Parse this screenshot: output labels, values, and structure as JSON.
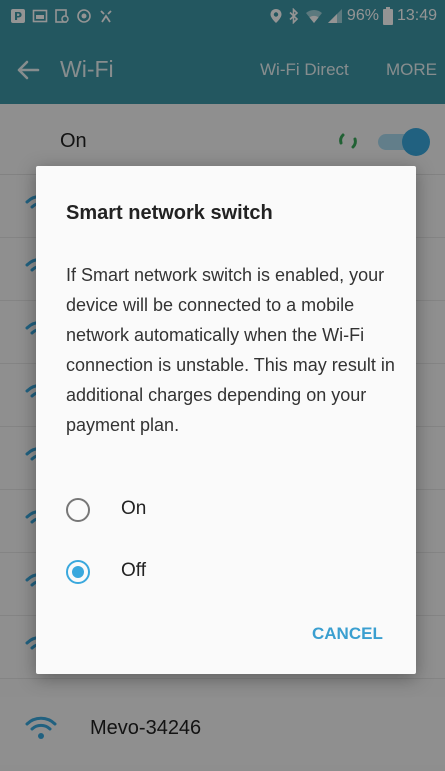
{
  "status_bar": {
    "battery": "96%",
    "time": "13:49"
  },
  "app_bar": {
    "title": "Wi-Fi",
    "wifi_direct": "Wi-Fi Direct",
    "more": "MORE"
  },
  "wifi_toggle": {
    "label": "On",
    "state": "on"
  },
  "networks": [
    {
      "name": "Mevo-34246"
    }
  ],
  "dialog": {
    "title": "Smart network switch",
    "body": "If Smart network switch is enabled, your device will be connected to a mobile network automatically when the Wi-Fi connection is unstable. This may result in additional charges depending on your payment plan.",
    "options": [
      {
        "label": "On",
        "selected": false
      },
      {
        "label": "Off",
        "selected": true
      }
    ],
    "cancel": "CANCEL"
  },
  "colors": {
    "accent": "#3aa8dd",
    "app_bar": "#3d96a6"
  },
  "icons": [
    "pin-icon",
    "bluetooth-icon",
    "wifi-icon",
    "signal-icon",
    "battery-icon",
    "back-arrow-icon",
    "spinner-icon",
    "wifi-icon"
  ]
}
